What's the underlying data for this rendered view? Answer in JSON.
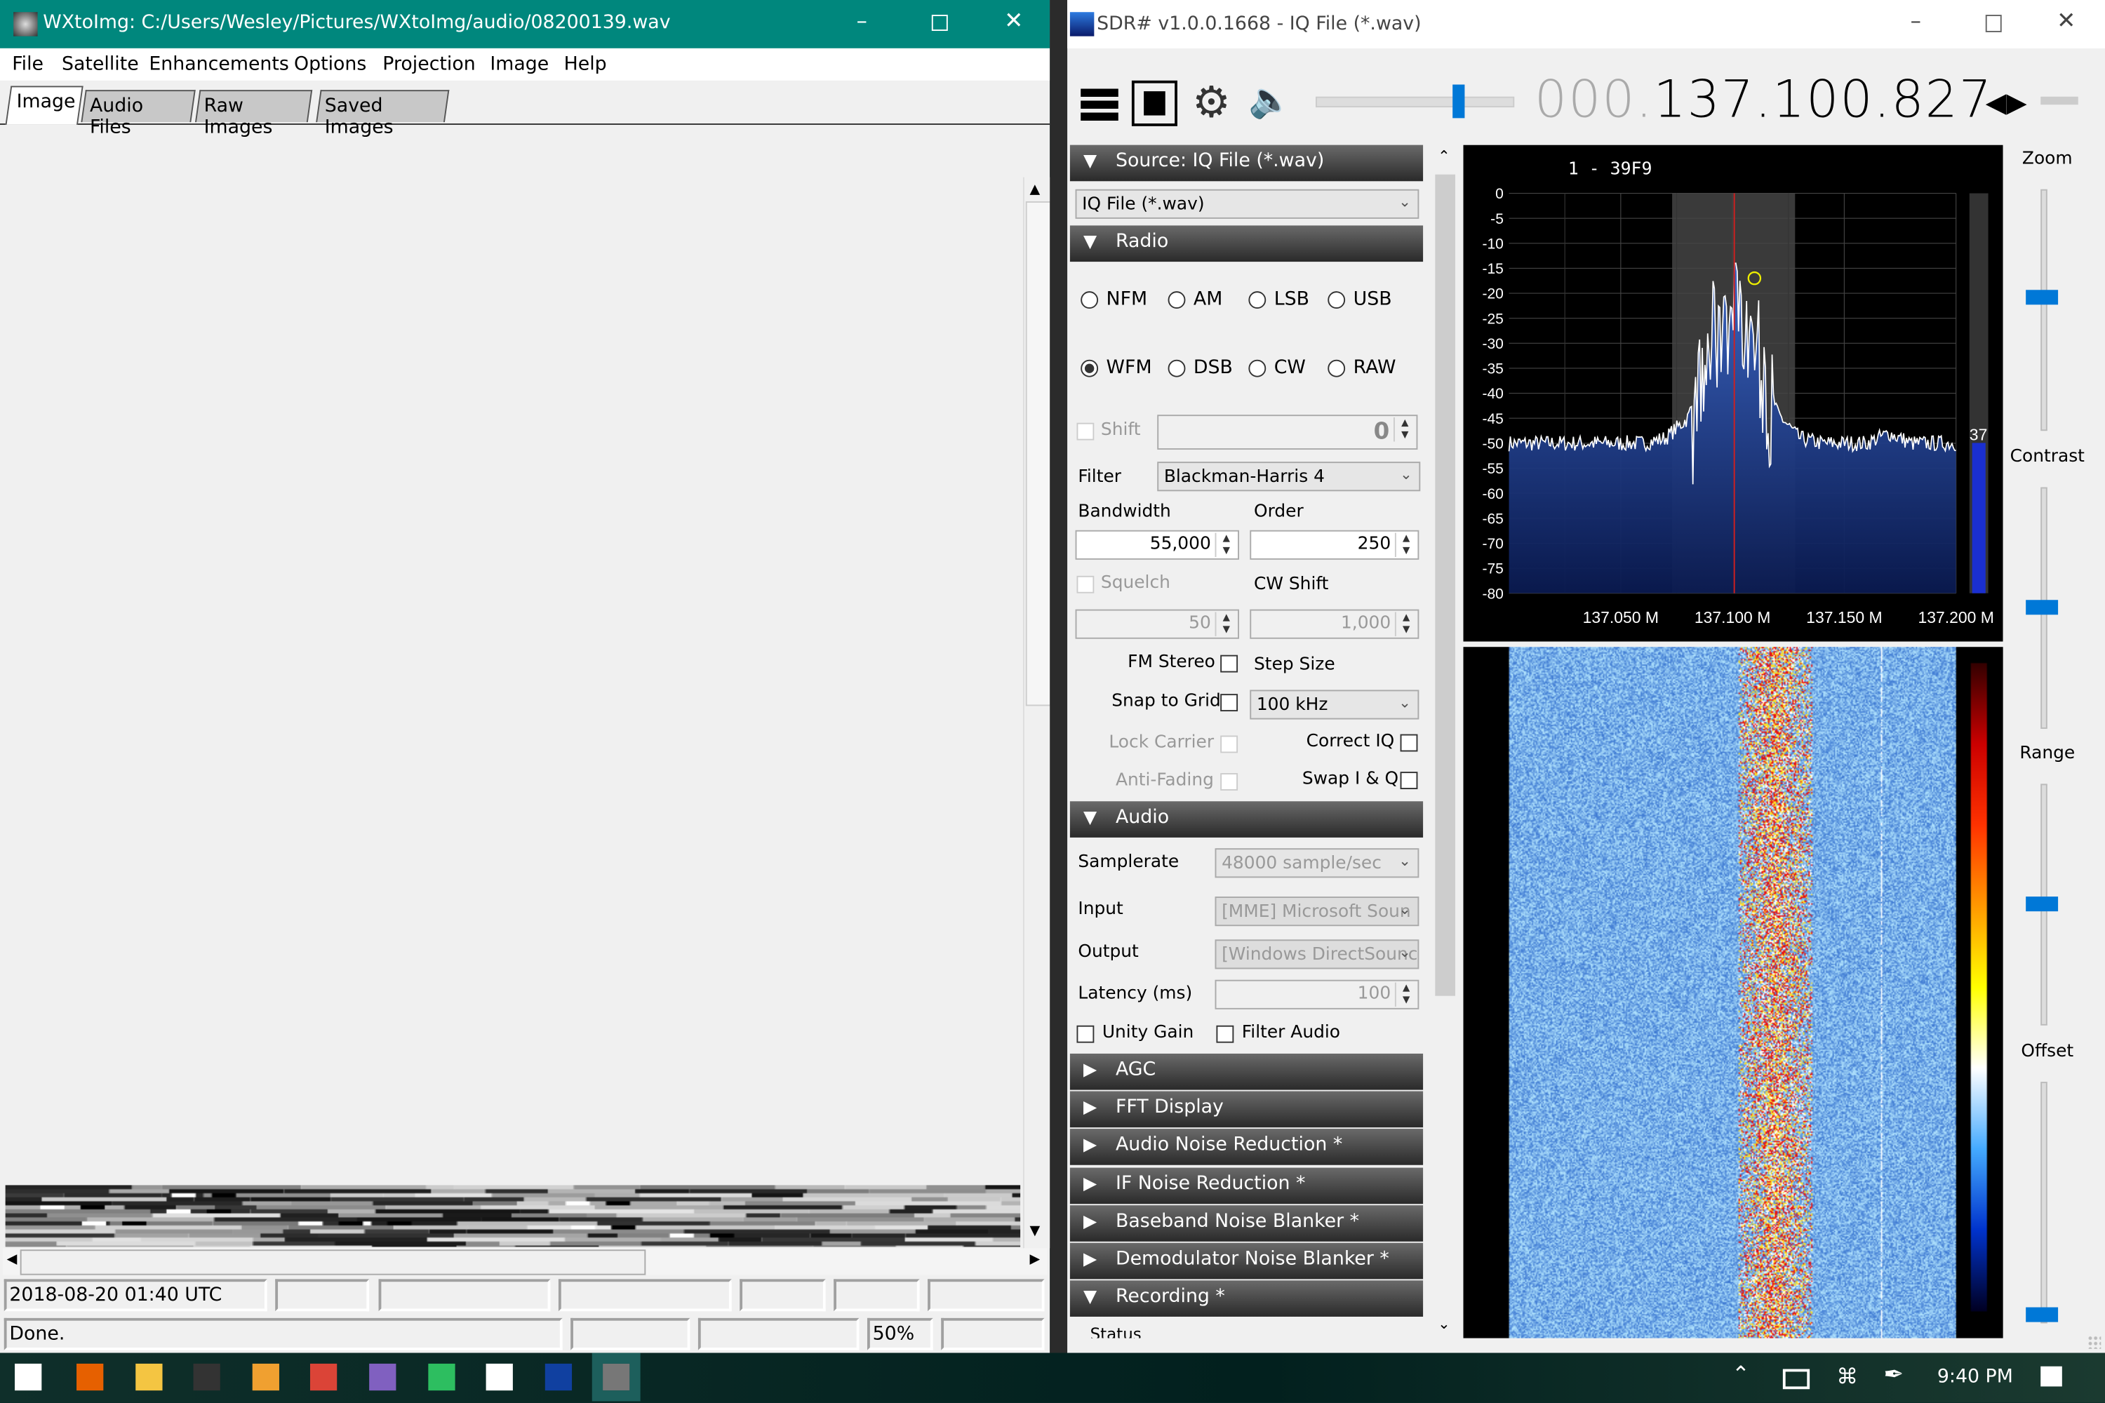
{
  "wxtoimg": {
    "title": "WXtoImg: C:/Users/Wesley/Pictures/WXtoImg/audio/08200139.wav",
    "menu": [
      "File",
      "Satellite",
      "Enhancements",
      "Options",
      "Projection",
      "Image",
      "Help"
    ],
    "tabs": [
      "Image",
      "Audio Files",
      "Raw Images",
      "Saved Images"
    ],
    "active_tab": "Image",
    "status": {
      "time": "2018-08-20 01:40 UTC",
      "message": "Done.",
      "progress": "50%"
    }
  },
  "sdr": {
    "title": "SDR# v1.0.0.1668 - IQ File (*.wav)",
    "frequency_prefix": "000.",
    "frequency": "137.100.827",
    "volume_level_percent": 75,
    "source": {
      "header": "Source: IQ File (*.wav)",
      "selected": "IQ File (*.wav)"
    },
    "radio": {
      "header": "Radio",
      "modes": [
        "NFM",
        "AM",
        "LSB",
        "USB",
        "WFM",
        "DSB",
        "CW",
        "RAW"
      ],
      "selected_mode": "WFM",
      "shift_label": "Shift",
      "shift_value": "0",
      "filter_label": "Filter",
      "filter_value": "Blackman-Harris 4",
      "bandwidth_label": "Bandwidth",
      "bandwidth_value": "55,000",
      "order_label": "Order",
      "order_value": "250",
      "squelch_label": "Squelch",
      "squelch_value": "50",
      "cwshift_label": "CW Shift",
      "cwshift_value": "1,000",
      "fm_stereo": "FM Stereo",
      "step_size": "Step Size",
      "snap_to_grid": "Snap to Grid",
      "step_value": "100 kHz",
      "lock_carrier": "Lock Carrier",
      "correct_iq": "Correct IQ",
      "anti_fading": "Anti-Fading",
      "swap_iq": "Swap I & Q"
    },
    "audio": {
      "header": "Audio",
      "samplerate_label": "Samplerate",
      "samplerate_value": "48000 sample/sec",
      "input_label": "Input",
      "input_value": "[MME] Microsoft Soun",
      "output_label": "Output",
      "output_value": "[Windows DirectSounc",
      "latency_label": "Latency (ms)",
      "latency_value": "100",
      "unity_gain": "Unity Gain",
      "filter_audio": "Filter Audio"
    },
    "collapsed_sections": [
      "AGC",
      "FFT Display",
      "Audio Noise Reduction *",
      "IF Noise Reduction *",
      "Baseband Noise Blanker *",
      "Demodulator Noise Blanker *"
    ],
    "recording": {
      "header": "Recording *",
      "status_label": "Status"
    },
    "spectrum_header": "1    -  39F9",
    "side_level": "37",
    "sliders": [
      {
        "label": "Zoom",
        "level": 0.55
      },
      {
        "label": "Contrast",
        "level": 0.5
      },
      {
        "label": "Range",
        "level": 0.5
      },
      {
        "label": "Offset",
        "level": 0.03
      }
    ],
    "colors": {
      "accent": "#0078d7",
      "filter_band": "#3a3a3a",
      "center_line": "#d02020",
      "spectrum_fill_top": "#3a66c8",
      "spectrum_fill_bottom": "#0a1a50"
    }
  },
  "chart_data": {
    "type": "line",
    "ylim": [
      -80,
      0
    ],
    "xlim": [
      137.0,
      137.2
    ],
    "yticks": [
      "0",
      "-5",
      "-10",
      "-15",
      "-20",
      "-25",
      "-30",
      "-35",
      "-40",
      "-45",
      "-50",
      "-55",
      "-60",
      "-65",
      "-70",
      "-75",
      "-80"
    ],
    "xticks": [
      "137.050 M",
      "137.100 M",
      "137.150 M",
      "137.200 M"
    ],
    "grid": true,
    "center_frequency": 137.1008,
    "filter_band": [
      137.073,
      137.128
    ],
    "x": [
      137.0,
      137.02,
      137.04,
      137.06,
      137.07,
      137.08,
      137.085,
      137.09,
      137.095,
      137.1,
      137.105,
      137.11,
      137.115,
      137.12,
      137.13,
      137.14,
      137.16,
      137.17,
      137.18,
      137.2
    ],
    "y": [
      -50,
      -50,
      -50,
      -50,
      -49,
      -45,
      -38,
      -28,
      -22,
      -18,
      -20,
      -26,
      -35,
      -44,
      -49,
      -50,
      -50,
      -48,
      -50,
      -50
    ]
  },
  "taskbar": {
    "time": "9:40 PM",
    "icons": [
      "windows-start",
      "firefox",
      "file-explorer",
      "terminal",
      "app-f",
      "chrome",
      "pidgin",
      "evernote",
      "photos",
      "sdrsharp",
      "wxtoimg"
    ]
  }
}
